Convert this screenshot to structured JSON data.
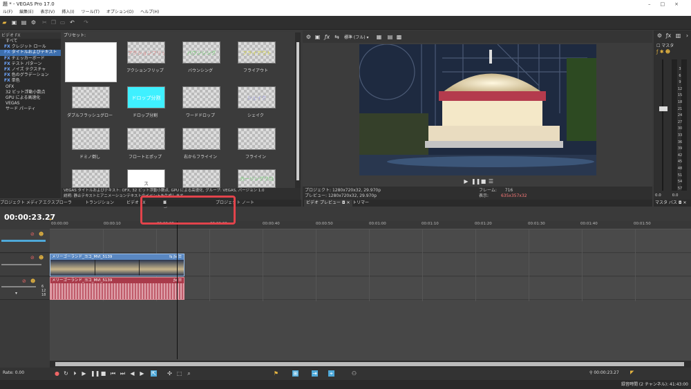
{
  "window": {
    "title": "題 *  - VEGAS Pro 17.0"
  },
  "menu": [
    "ル(F)",
    "編集(E)",
    "表示(V)",
    "挿入(I)",
    "ツール(T)",
    "オプション(O)",
    "ヘルプ(H)"
  ],
  "plugins": {
    "header": "ビデオ FX",
    "items": [
      {
        "fx": "",
        "label": "すべて"
      },
      {
        "fx": "FX",
        "label": "クレジット ロール"
      },
      {
        "fx": "FX",
        "label": "タイトルおよびテキスト"
      },
      {
        "fx": "FX",
        "label": "チェッカーボード"
      },
      {
        "fx": "FX",
        "label": "テスト パターン"
      },
      {
        "fx": "FX",
        "label": "ノイズ テクスチャ"
      },
      {
        "fx": "FX",
        "label": "色のグラデーション"
      },
      {
        "fx": "FX",
        "label": "単色"
      },
      {
        "fx": "",
        "label": "OFX"
      },
      {
        "fx": "",
        "label": "32 ビット浮動小数点"
      },
      {
        "fx": "",
        "label": "GPU による高速化"
      },
      {
        "fx": "",
        "label": "VEGAS"
      },
      {
        "fx": "",
        "label": "サード パーティ"
      }
    ]
  },
  "presets": {
    "header": "プリセット:",
    "items": [
      {
        "label": "",
        "thumb_text": ""
      },
      {
        "label": "アクションフリップ",
        "thumb_text": "アクションフリップ"
      },
      {
        "label": "バウンシング",
        "thumb_text": "バウンシング"
      },
      {
        "label": "フライアウト",
        "thumb_text": "フライアウト"
      },
      {
        "label": "ダブルフラッシュグロー",
        "thumb_text": ""
      },
      {
        "label": "ドロップ分割",
        "thumb_text": "ドロップ分割"
      },
      {
        "label": "ワードドロップ",
        "thumb_text": ""
      },
      {
        "label": "シェイク",
        "thumb_text": "シェイク"
      },
      {
        "label": "ドミノ倒し",
        "thumb_text": ""
      },
      {
        "label": "フロートとポップ",
        "thumb_text": ""
      },
      {
        "label": "右からフライイン",
        "thumb_text": ""
      },
      {
        "label": "フライイン",
        "thumb_text": ""
      },
      {
        "label": "",
        "thumb_text": ""
      },
      {
        "label": "",
        "thumb_text": "ス"
      },
      {
        "label": "",
        "thumb_text": ""
      },
      {
        "label": "",
        "thumb_text": "カーリングクロ"
      }
    ],
    "description_line1": "VEGAS タイトルおよびテキスト: OFX, 32 ビット浮動小数点, GPU による高速化, グループ: VEGAS, バージョン 1.0",
    "description_line2": "説明: 静止テキストとアニメーションテキストのイベントを生成します。"
  },
  "left_tabs": [
    "プロジェクト メディア",
    "エクスプローラ",
    "トランジション",
    "ビデオ FX",
    "メディア ジェネレータ",
    "プロジェクト ノート"
  ],
  "preview": {
    "toolbar_mode": "標準 (フル)",
    "project_label": "プロジェクト:",
    "project_value": "1280x720x32, 29.970p",
    "preview_label": "プレビュー:",
    "preview_value": "1280x720x32, 29.970p",
    "frame_label": "フレーム:",
    "frame_value": "716",
    "display_label": "表示:",
    "display_value": "635x357x32",
    "tabs": [
      "ビデオ プレビュー",
      "トリマー"
    ]
  },
  "master": {
    "label": "マスタ",
    "scale": [
      "3",
      "6",
      "9",
      "12",
      "15",
      "18",
      "21",
      "24",
      "27",
      "30",
      "33",
      "36",
      "39",
      "42",
      "45",
      "48",
      "51",
      "54",
      "57"
    ],
    "bottom_left": "0.0",
    "bottom_right": "0.0",
    "tab": "マスタ バス"
  },
  "timeline": {
    "time": "00:00:23.27",
    "ruler": [
      "00:00:00",
      "00:00:10",
      "00:00:20",
      "00:00:30",
      "00:00:40",
      "00:00:50",
      "00:01:00",
      "00:01:10",
      "00:01:20",
      "00:01:30",
      "00:01:40",
      "00:01:50"
    ],
    "video_clip": "メリーゴーランド_ヨコ_MVI_5139",
    "audio_clip": "メリーゴーランド_ヨコ_MVI_5139",
    "db_scale": [
      "6",
      "12",
      "18"
    ],
    "rate": "0.00",
    "cursor_time": "00:00:23.27",
    "status": "録音時間 (2 チャンネル): 41:43:00"
  },
  "colors": {
    "accent": "#4fa9d9",
    "highlight_box": "#e2434b",
    "video_clip": "#6c9bd4",
    "audio_clip": "#b94a5a"
  }
}
